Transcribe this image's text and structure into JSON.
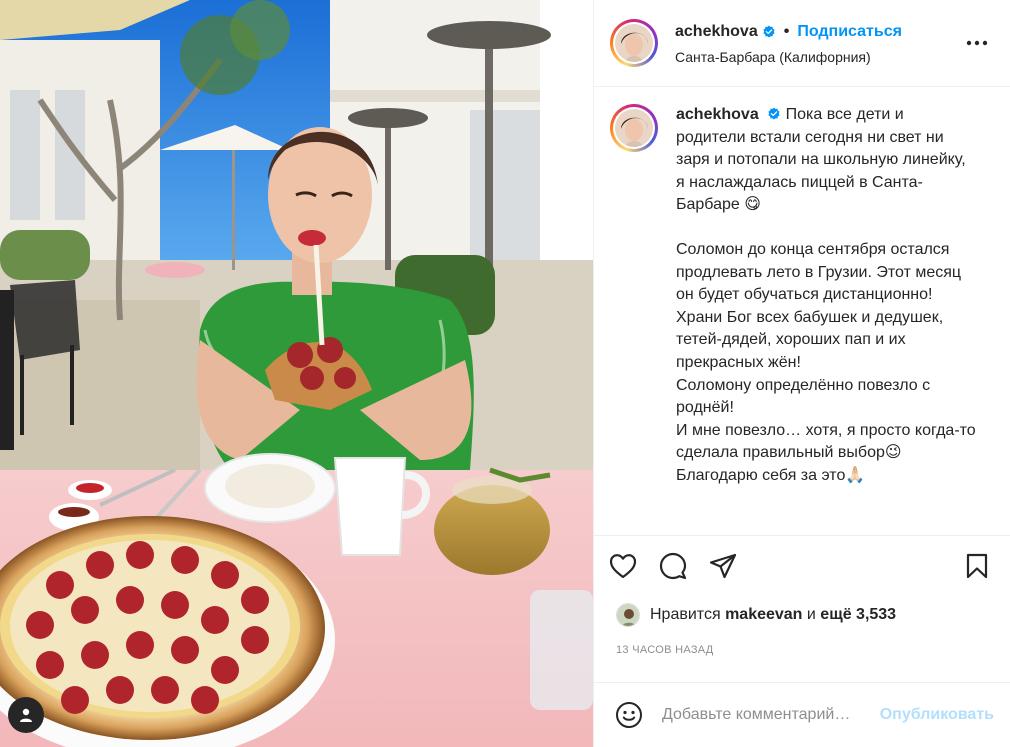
{
  "post": {
    "username": "achekhova",
    "separator": "•",
    "follow_label": "Подписаться",
    "location": "Санта-Барбара (Калифорния)"
  },
  "caption": {
    "username": "achekhova",
    "lines": [
      "Пока все дети и родители встали сегодня ни свет ни заря и потопали на школьную линейку, я наслаждалась пиццей в Санта-Барбаре 😋",
      "",
      "Соломон до конца сентября остался продлевать лето в Грузии. Этот месяц он будет обучаться дистанционно!",
      "Храни Бог всех бабушек и дедушек, тетей-дядей, хороших пап и их прекрасных жён!",
      "Соломону определённо повезло с роднёй!",
      "И мне повезло… хотя, я просто когда-то сделала правильный выбор😉",
      "Благодарю себя за это🙏🏻"
    ]
  },
  "likes": {
    "prefix": "Нравится",
    "user": "makeevan",
    "joiner": "и",
    "others": "ещё 3,533"
  },
  "timestamp": "13 часов назад",
  "comment": {
    "placeholder": "Добавьте комментарий…",
    "publish_label": "Опубликовать"
  },
  "icons": {
    "verified": "verified-badge-icon",
    "more": "more-options-icon",
    "like": "heart-icon",
    "comment": "comment-icon",
    "share": "paper-plane-icon",
    "save": "bookmark-icon",
    "emoji": "smiley-icon",
    "tagged": "person-icon"
  },
  "colors": {
    "accent": "#0095f6",
    "publish_disabled": "#b2dffc",
    "secondary_text": "#8e8e8e",
    "border": "#efefef"
  }
}
